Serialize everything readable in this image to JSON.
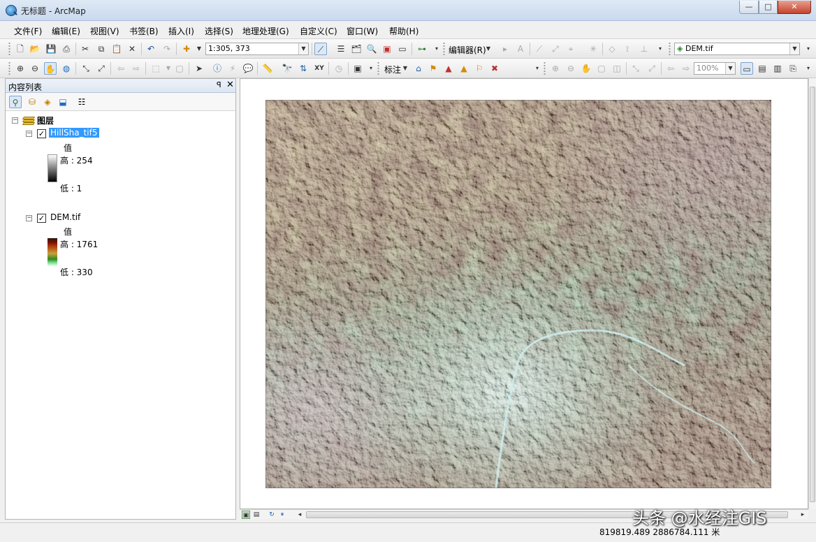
{
  "window": {
    "title": "无标题 - ArcMap",
    "minimize": "—",
    "maximize": "□",
    "close": "✕"
  },
  "menu": [
    "文件(F)",
    "编辑(E)",
    "视图(V)",
    "书签(B)",
    "插入(I)",
    "选择(S)",
    "地理处理(G)",
    "自定义(C)",
    "窗口(W)",
    "帮助(H)"
  ],
  "toolbar": {
    "scale": "1:305, 373",
    "editor_label": "编辑器(R)",
    "layer_combo": "DEM.tif",
    "label_menu": "标注",
    "zoom_percent": "100%"
  },
  "toc": {
    "title": "内容列表",
    "pin": "ㅍ",
    "close": "✕",
    "group_label": "图层",
    "layers": [
      {
        "name": "HillSha_tif5",
        "checked": true,
        "selected": true,
        "field": "值",
        "high": "高 : 254",
        "low": "低 : 1"
      },
      {
        "name": "DEM.tif",
        "checked": true,
        "selected": false,
        "field": "值",
        "high": "高 : 1761",
        "low": "低 : 330"
      }
    ]
  },
  "icons": {
    "list_by_drawing_order": "list-drawing-order-icon",
    "list_by_source": "list-source-icon",
    "list_by_visibility": "list-visibility-icon",
    "list_by_selection": "list-selection-icon",
    "options": "options-icon"
  },
  "colors": {
    "accent_selected": "#3399ff",
    "dem_high": "#7a0f00",
    "dem_mid": "#c7a23c",
    "dem_low": "#8fe9a9"
  },
  "status": {
    "coordinates": "819819.489  2886784.111 米"
  },
  "watermark": "头条 @水经注GIS"
}
